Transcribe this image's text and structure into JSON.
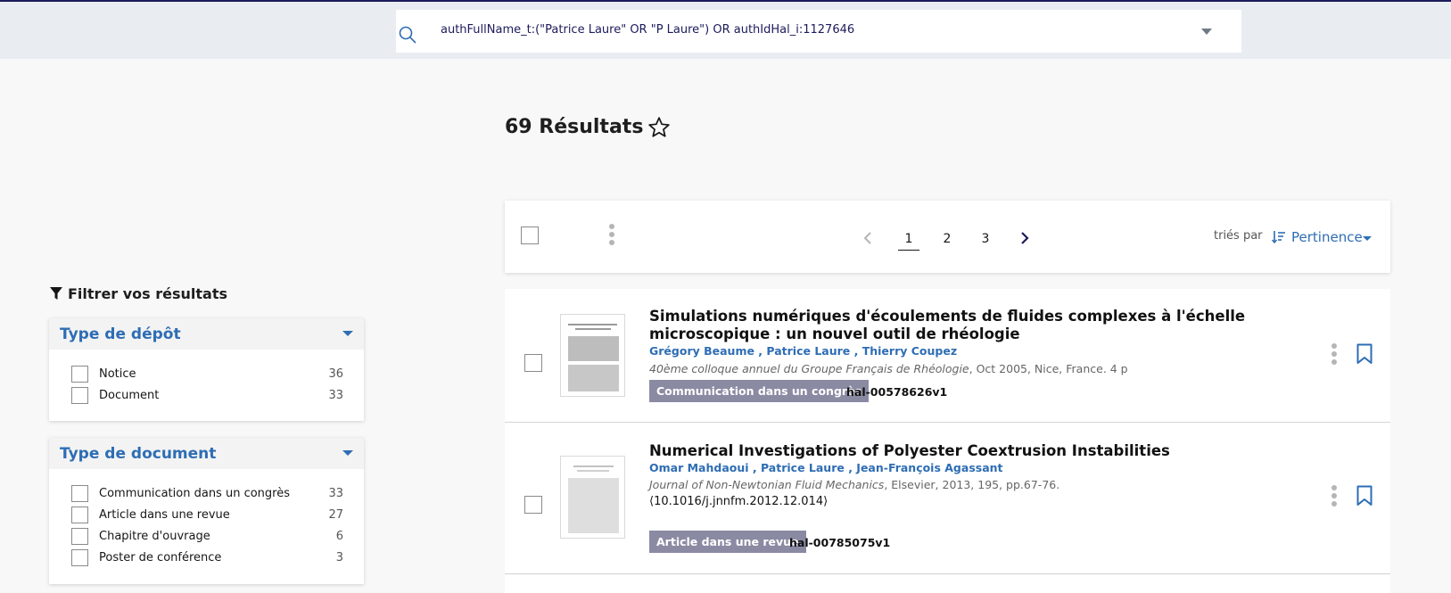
{
  "search": {
    "query": "authFullName_t:(\"Patrice Laure\" OR \"P Laure\") OR authIdHal_i:1127646"
  },
  "results": {
    "count_label": "69 Résultats"
  },
  "pagination": {
    "pages": [
      "1",
      "2",
      "3"
    ],
    "current": "1"
  },
  "sort": {
    "label": "triés par",
    "value": "Pertinence"
  },
  "filters": {
    "title": "Filtrer vos résultats",
    "facets": [
      {
        "title": "Type de dépôt",
        "items": [
          {
            "label": "Notice",
            "count": "36"
          },
          {
            "label": "Document",
            "count": "33"
          }
        ]
      },
      {
        "title": "Type de document",
        "items": [
          {
            "label": "Communication dans un congrès",
            "count": "33"
          },
          {
            "label": "Article dans une revue",
            "count": "27"
          },
          {
            "label": "Chapitre d'ouvrage",
            "count": "6"
          },
          {
            "label": "Poster de conférence",
            "count": "3"
          }
        ]
      }
    ]
  },
  "records": [
    {
      "title": "Simulations numériques d'écoulements de fluides complexes à l'échelle microscopique : un nouvel outil de rhéologie",
      "authors": "Grégory Beaume , Patrice Laure , Thierry Coupez",
      "source_journal": "40ème colloque annuel du Groupe Français de Rhéologie",
      "source_rest": ", Oct 2005, Nice, France. 4 p",
      "doi": "",
      "type": "Communication dans un congrès",
      "hal_id": "hal-00578626v1"
    },
    {
      "title": "Numerical Investigations of Polyester Coextrusion Instabilities",
      "authors": "Omar Mahdaoui , Patrice Laure , Jean-François Agassant",
      "source_journal": "Journal of Non-Newtonian Fluid Mechanics",
      "source_rest": ", Elsevier, 2013, 195, pp.67-76.",
      "doi": "⟨10.1016/j.jnnfm.2012.12.014⟩",
      "type": "Article dans une revue",
      "hal_id": "hal-00785075v1"
    }
  ],
  "colors": {
    "accent": "#2e6db4",
    "navy": "#1b1b5c",
    "badge": "#8b8aa3",
    "topbar": "#e9edf1"
  }
}
